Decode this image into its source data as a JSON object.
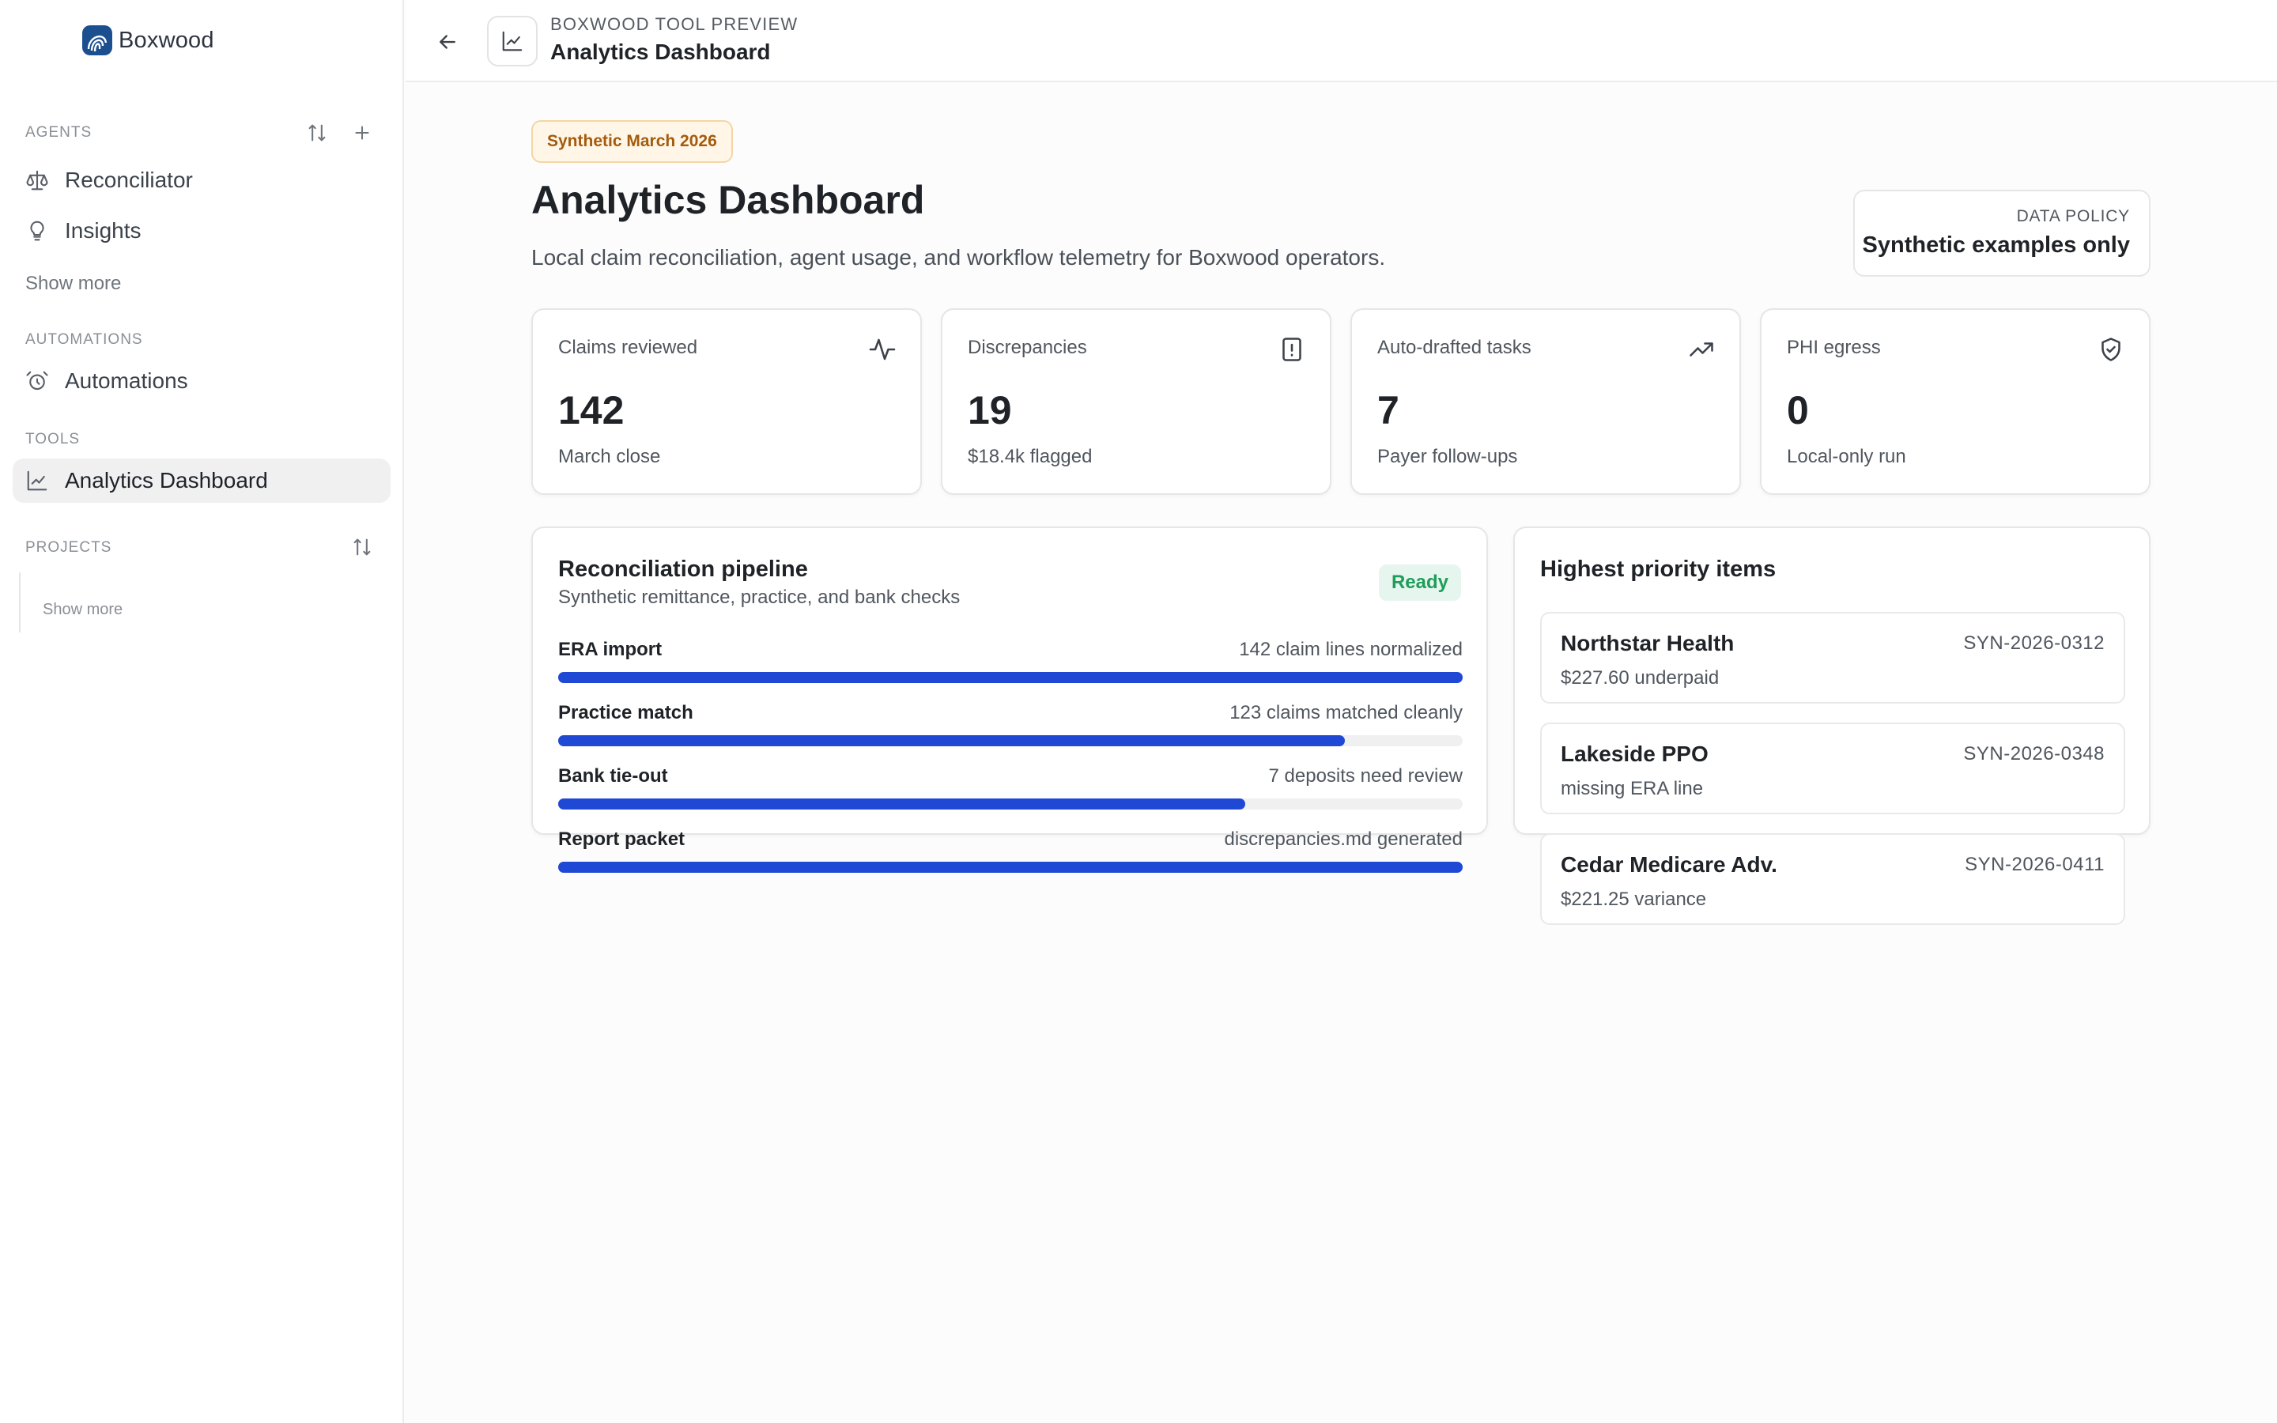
{
  "brand": {
    "name": "Boxwood"
  },
  "sidebar": {
    "agents_label": "Agents",
    "agents": [
      {
        "label": "Reconciliator",
        "icon": "scale-icon"
      },
      {
        "label": "Insights",
        "icon": "lightbulb-icon"
      }
    ],
    "agents_show_more": "Show more",
    "automations_label": "Automations",
    "automations": [
      {
        "label": "Automations",
        "icon": "alarm-clock-icon"
      }
    ],
    "tools_label": "Tools",
    "tools": [
      {
        "label": "Analytics Dashboard",
        "icon": "line-chart-icon",
        "active": true
      }
    ],
    "projects_label": "Projects",
    "projects_show_more": "Show more"
  },
  "topbar": {
    "kicker": "BOXWOOD TOOL PREVIEW",
    "title": "Analytics Dashboard"
  },
  "page": {
    "pill": "Synthetic March 2026",
    "title": "Analytics Dashboard",
    "subtitle": "Local claim reconciliation, agent usage, and workflow telemetry for Boxwood operators.",
    "policy_label": "DATA POLICY",
    "policy_value": "Synthetic examples only"
  },
  "stats": [
    {
      "label": "Claims reviewed",
      "value": "142",
      "sub": "March close",
      "icon": "activity-icon"
    },
    {
      "label": "Discrepancies",
      "value": "19",
      "sub": "$18.4k flagged",
      "icon": "alert-file-icon"
    },
    {
      "label": "Auto-drafted tasks",
      "value": "7",
      "sub": "Payer follow-ups",
      "icon": "trending-up-icon"
    },
    {
      "label": "PHI egress",
      "value": "0",
      "sub": "Local-only run",
      "icon": "shield-check-icon"
    }
  ],
  "pipeline": {
    "title": "Reconciliation pipeline",
    "subtitle": "Synthetic remittance, practice, and bank checks",
    "status": "Ready",
    "stages": [
      {
        "name": "ERA import",
        "note": "142 claim lines normalized",
        "progress": 1.0
      },
      {
        "name": "Practice match",
        "note": "123 claims matched cleanly",
        "progress": 0.87
      },
      {
        "name": "Bank tie-out",
        "note": "7 deposits need review",
        "progress": 0.76
      },
      {
        "name": "Report packet",
        "note": "discrepancies.md generated",
        "progress": 1.0
      }
    ]
  },
  "priority": {
    "title": "Highest priority items",
    "items": [
      {
        "name": "Northstar Health",
        "id": "SYN-2026-0312",
        "desc": "$227.60 underpaid"
      },
      {
        "name": "Lakeside PPO",
        "id": "SYN-2026-0348",
        "desc": "missing ERA line"
      },
      {
        "name": "Cedar Medicare Adv.",
        "id": "SYN-2026-0411",
        "desc": "$221.25 variance"
      }
    ]
  },
  "colors": {
    "accent": "#1f49d4",
    "ready": "#1f9d5a",
    "pill_text": "#a45b0b"
  }
}
